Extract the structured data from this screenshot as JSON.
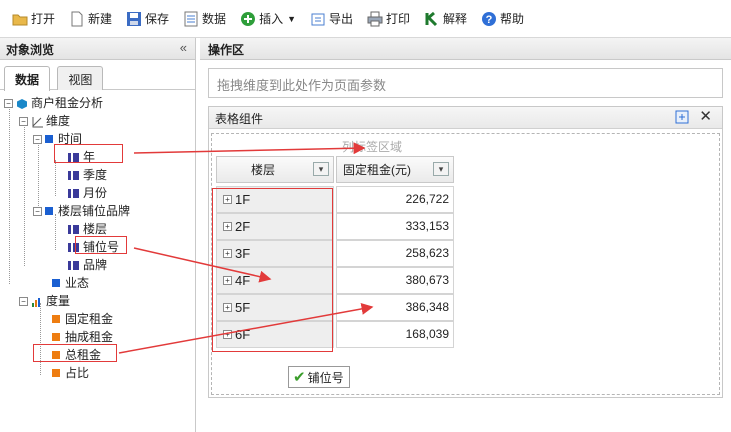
{
  "toolbar": {
    "open": "打开",
    "new": "新建",
    "save": "保存",
    "data": "数据",
    "insert": "插入",
    "export": "导出",
    "print": "打印",
    "explain": "解释",
    "help": "帮助"
  },
  "left_panel": {
    "title": "对象浏览",
    "tabs": [
      "数据",
      "视图"
    ],
    "tree": {
      "root": "商户租金分析",
      "dimensions": "维度",
      "time": "时间",
      "year": "年",
      "quarter": "季度",
      "month": "月份",
      "floor_brand": "楼层铺位品牌",
      "floor": "楼层",
      "shop_no": "铺位号",
      "brand": "品牌",
      "business": "业态",
      "measures": "度量",
      "fixed_rent": "固定租金",
      "commission_rent": "抽成租金",
      "total_rent": "总租金",
      "ratio": "占比"
    }
  },
  "work_area": {
    "title": "操作区",
    "param_placeholder": "拖拽维度到此处作为页面参数",
    "component_title": "表格组件",
    "column_zone": "列标签区域",
    "row_header": "楼层",
    "col_header": "固定租金(元)",
    "drag_label": "铺位号",
    "rows": [
      {
        "floor": "1F",
        "value": "226,722"
      },
      {
        "floor": "2F",
        "value": "333,153"
      },
      {
        "floor": "3F",
        "value": "258,623"
      },
      {
        "floor": "4F",
        "value": "380,673"
      },
      {
        "floor": "5F",
        "value": "386,348"
      },
      {
        "floor": "6F",
        "value": "168,039"
      }
    ]
  },
  "colors": {
    "arrow": "#e23a3a",
    "dimension_marker": "#1a5fd1",
    "measure_marker": "#ee7d11"
  }
}
